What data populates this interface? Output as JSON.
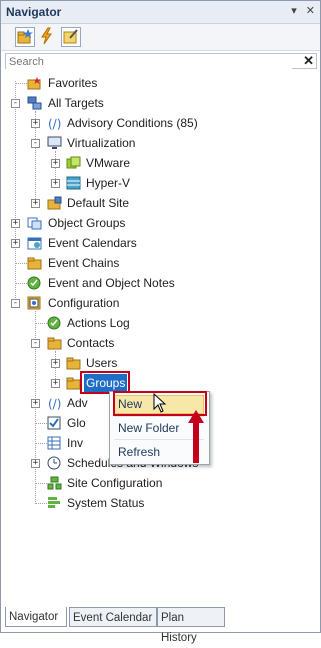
{
  "panel": {
    "title": "Navigator",
    "pin": "▾",
    "close": "✕"
  },
  "search": {
    "placeholder": "Search",
    "clear": "✕"
  },
  "tree": {
    "favorites": "Favorites",
    "all_targets": "All Targets",
    "advisory_conditions": "Advisory Conditions (85)",
    "virtualization": "Virtualization",
    "vmware": "VMware",
    "hyperv": "Hyper-V",
    "default_site": "Default Site",
    "object_groups": "Object Groups",
    "event_calendars": "Event Calendars",
    "event_chains": "Event Chains",
    "event_object_notes": "Event and Object Notes",
    "configuration": "Configuration",
    "actions_log": "Actions Log",
    "contacts": "Contacts",
    "users": "Users",
    "groups": "Groups",
    "advisory_partial": "Adv",
    "global_partial": "Glo",
    "inventory_partial": "Inv",
    "schedules_partial": "Schedules and Windows",
    "site_configuration": "Site Configuration",
    "system_status": "System Status"
  },
  "context_menu": {
    "new": "New",
    "new_folder": "New Folder",
    "refresh": "Refresh"
  },
  "tabs": [
    "Navigator",
    "Event Calendar",
    "Plan History"
  ],
  "colors": {
    "accent": "#1e6ec8",
    "highlight_box": "#c4001a",
    "menu_hover": "#f7e7a8"
  }
}
